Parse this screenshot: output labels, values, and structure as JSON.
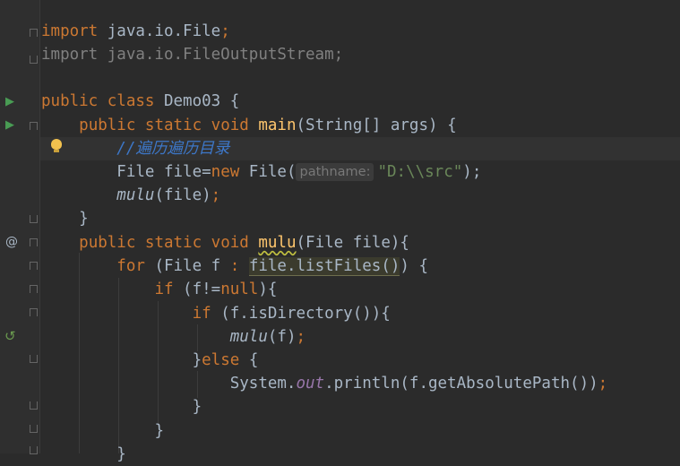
{
  "editor": {
    "lines": [
      {
        "id": "l1",
        "import_kw": "import",
        "path": " java.io.File",
        "semi": ";"
      },
      {
        "id": "l2",
        "import_kw": "import",
        "path": " java.io.FileOutputStream;"
      },
      {
        "id": "l4",
        "kw1": "public",
        "kw2": " class",
        "name": " Demo03 {"
      },
      {
        "id": "l5",
        "indent": "    ",
        "kw": "public static void ",
        "fn": "main",
        "rest": "(String[] args) {"
      },
      {
        "id": "l6",
        "indent": "        ",
        "comment": "//遍历遍历目录"
      },
      {
        "id": "l7",
        "indent": "        ",
        "a": "File file=",
        "kw": "new",
        "b": " File(",
        "hint": "pathname:",
        "str": "\"D:\\\\src\"",
        "c": ");"
      },
      {
        "id": "l8",
        "indent": "        ",
        "it": "mulu",
        "rest": "(file)",
        "semi": ";"
      },
      {
        "id": "l9",
        "indent": "    ",
        "rest": "}"
      },
      {
        "id": "l10",
        "indent": "    ",
        "kw": "public static void ",
        "fn": "mulu",
        "rest": "(File file){"
      },
      {
        "id": "l11",
        "indent": "        ",
        "kw": "for",
        "a": " (File f ",
        "colon": ": ",
        "sel": "file.listFiles()",
        "b": ") {"
      },
      {
        "id": "l12",
        "indent": "            ",
        "kw": "if",
        "a": " (f!=",
        "kw2": "null",
        "b": "){"
      },
      {
        "id": "l13",
        "indent": "                ",
        "kw": "if",
        "a": " (f.isDirectory()){"
      },
      {
        "id": "l14",
        "indent": "                    ",
        "it": "mulu",
        "rest": "(f)",
        "semi": ";"
      },
      {
        "id": "l15",
        "indent": "                ",
        "a": "}",
        "kw": "else",
        "b": " {"
      },
      {
        "id": "l16",
        "indent": "                    ",
        "a": "System.",
        "field": "out",
        "b": ".println(f.getAbsolutePath())",
        "semi": ";"
      },
      {
        "id": "l17",
        "indent": "                ",
        "rest": "}"
      },
      {
        "id": "l18",
        "indent": "            ",
        "rest": "}"
      },
      {
        "id": "l19",
        "indent": "        ",
        "rest": "}"
      }
    ]
  },
  "gutter": {
    "run_icon": "play-triangle-icon",
    "override_icon": "at-sign-icon",
    "recursion_icon": "recursion-icon",
    "intention_icon": "lightbulb-icon",
    "at_glyph": "@",
    "run_glyph": "▶",
    "recur_glyph": "↺"
  },
  "colors": {
    "background": "#2b2b2b",
    "keyword": "#cc7832",
    "function": "#ffc66d",
    "string": "#6a8759",
    "text": "#a9b7c6",
    "comment": "#3d77c8",
    "field": "#9876aa"
  }
}
